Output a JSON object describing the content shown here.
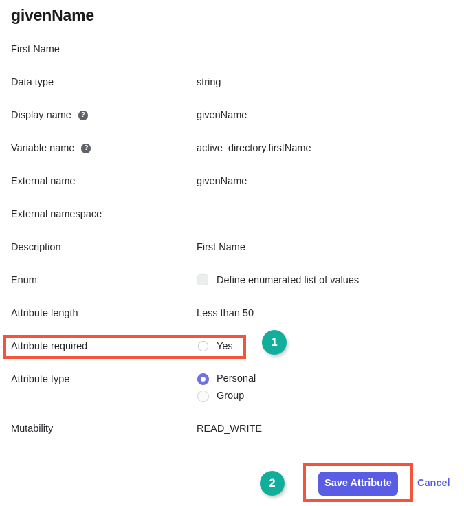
{
  "header": {
    "title": "givenName",
    "subtitle": "First Name"
  },
  "fields": [
    {
      "label": "Data type",
      "value": "string"
    },
    {
      "label": "Display name",
      "value": "givenName",
      "help": "?"
    },
    {
      "label": "Variable name",
      "value": "active_directory.firstName",
      "help": "?"
    },
    {
      "label": "External name",
      "value": "givenName"
    },
    {
      "label": "External namespace",
      "value": ""
    },
    {
      "label": "Description",
      "value": "First Name"
    }
  ],
  "enum_row": {
    "label": "Enum",
    "checkbox_label": "Define enumerated list of values",
    "checked": false
  },
  "attribute_length": {
    "label": "Attribute length",
    "value": "Less than 50"
  },
  "attribute_required": {
    "label": "Attribute required",
    "checkbox_label": "Yes",
    "checked": false
  },
  "attribute_type": {
    "label": "Attribute type",
    "options": [
      {
        "label": "Personal",
        "selected": true
      },
      {
        "label": "Group",
        "selected": false
      }
    ]
  },
  "mutability": {
    "label": "Mutability",
    "value": "READ_WRITE"
  },
  "footer": {
    "save_label": "Save Attribute",
    "cancel_label": "Cancel"
  },
  "annotations": {
    "badge_one": "1",
    "badge_two": "2",
    "highlight_color": "#f4543c",
    "badge_color": "#10ae9b"
  },
  "colors": {
    "primary_button": "#5a5ce4",
    "link": "#4f5ce6",
    "radio_selected": "#6f72e0"
  }
}
